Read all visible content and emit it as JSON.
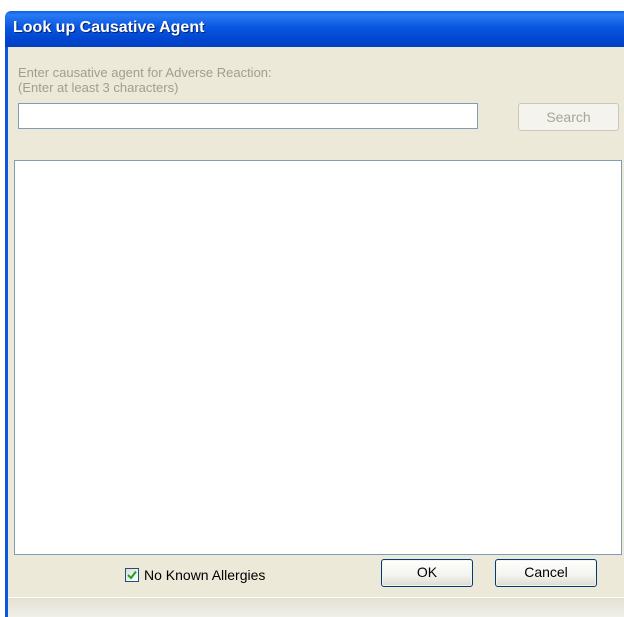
{
  "window": {
    "title": "Look up Causative Agent"
  },
  "search": {
    "prompt_line1": "Enter causative agent for Adverse Reaction:",
    "prompt_line2": "(Enter at least 3 characters)",
    "value": "",
    "button_label": "Search",
    "button_enabled": false
  },
  "results": {
    "items": []
  },
  "options": {
    "no_known_allergies_label": "No Known Allergies",
    "no_known_allergies_checked": true
  },
  "actions": {
    "ok_label": "OK",
    "cancel_label": "Cancel"
  },
  "icons": {
    "checkmark": "check-icon"
  },
  "colors": {
    "titlebar": "#0148d3",
    "dialog_background": "#ece9d8",
    "checkmark": "#21a121",
    "disabled_text": "#a29e8e"
  }
}
